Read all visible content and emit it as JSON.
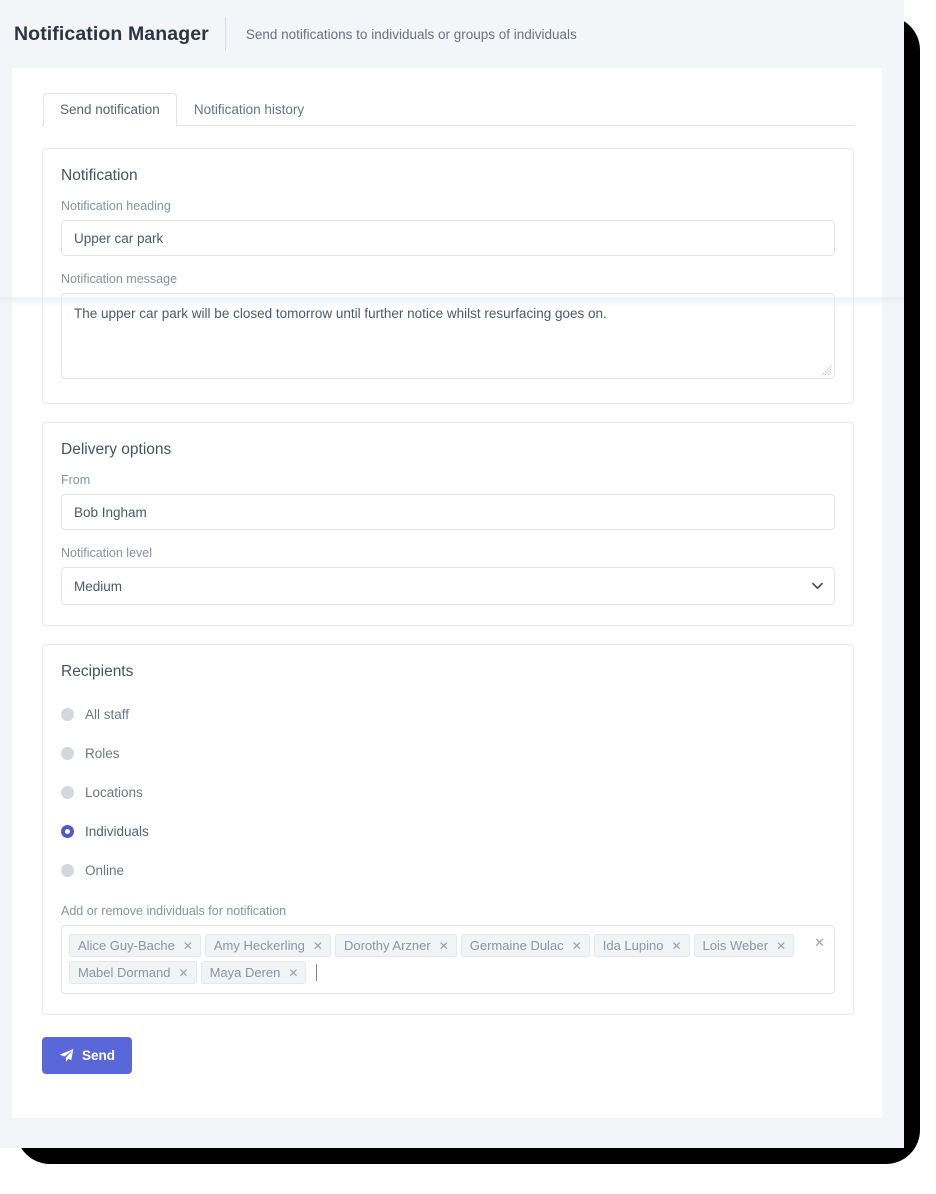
{
  "header": {
    "title": "Notification Manager",
    "subtitle": "Send notifications to individuals or groups of individuals"
  },
  "tabs": [
    {
      "label": "Send notification",
      "active": true
    },
    {
      "label": "Notification history",
      "active": false
    }
  ],
  "notification_panel": {
    "title": "Notification",
    "heading_label": "Notification heading",
    "heading_value": "Upper car park",
    "message_label": "Notification message",
    "message_value": "The upper car park will be closed tomorrow until further notice whilst resurfacing goes on."
  },
  "delivery_panel": {
    "title": "Delivery options",
    "from_label": "From",
    "from_value": "Bob Ingham",
    "level_label": "Notification level",
    "level_value": "Medium",
    "level_options": [
      "Medium"
    ]
  },
  "recipients_panel": {
    "title": "Recipients",
    "options": [
      {
        "label": "All staff",
        "selected": false
      },
      {
        "label": "Roles",
        "selected": false
      },
      {
        "label": "Locations",
        "selected": false
      },
      {
        "label": "Individuals",
        "selected": true
      },
      {
        "label": "Online",
        "selected": false
      }
    ],
    "tags_label": "Add or remove individuals for notification",
    "tags": [
      "Alice Guy-Bache",
      "Amy Heckerling",
      "Dorothy Arzner",
      "Germaine Dulac",
      "Ida Lupino",
      "Lois Weber",
      "Mabel Dormand",
      "Maya Deren"
    ],
    "tag_remove_glyph": "✕",
    "clear_all_glyph": "✕"
  },
  "actions": {
    "send_label": "Send",
    "send_icon": "paper-plane-icon"
  },
  "colors": {
    "accent": "#5a67d8",
    "radio_selected": "#4f58cf",
    "radio_unselected": "#d5d7de",
    "page_background": "#f4f5f9",
    "card_background": "#ffffff",
    "frame": "#000000",
    "border": "#e3e5ea",
    "label_text": "#8a90a0",
    "value_text": "#51576a"
  }
}
